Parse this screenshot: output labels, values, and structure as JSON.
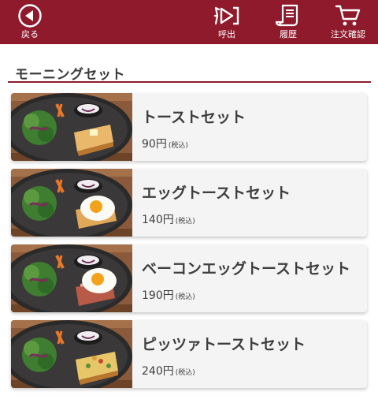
{
  "header": {
    "back_label": "戻る",
    "call_label": "呼出",
    "history_label": "履歴",
    "cart_label": "注文確認"
  },
  "section": {
    "title": "モーニングセット"
  },
  "items": [
    {
      "name": "トーストセット",
      "price": "90円",
      "tax": "(税込)",
      "topping": "toast"
    },
    {
      "name": "エッグトーストセット",
      "price": "140円",
      "tax": "(税込)",
      "topping": "egg"
    },
    {
      "name": "ベーコンエッグトーストセット",
      "price": "190円",
      "tax": "(税込)",
      "topping": "bacon-egg"
    },
    {
      "name": "ピッツァトーストセット",
      "price": "240円",
      "tax": "(税込)",
      "topping": "pizza"
    }
  ],
  "colors": {
    "brand": "#8f1a2c",
    "card_bg": "#f4f4f4",
    "text": "#3e3e3e"
  },
  "icons": [
    "back-arrow-icon",
    "bell-call-icon",
    "receipt-history-icon",
    "cart-icon"
  ]
}
